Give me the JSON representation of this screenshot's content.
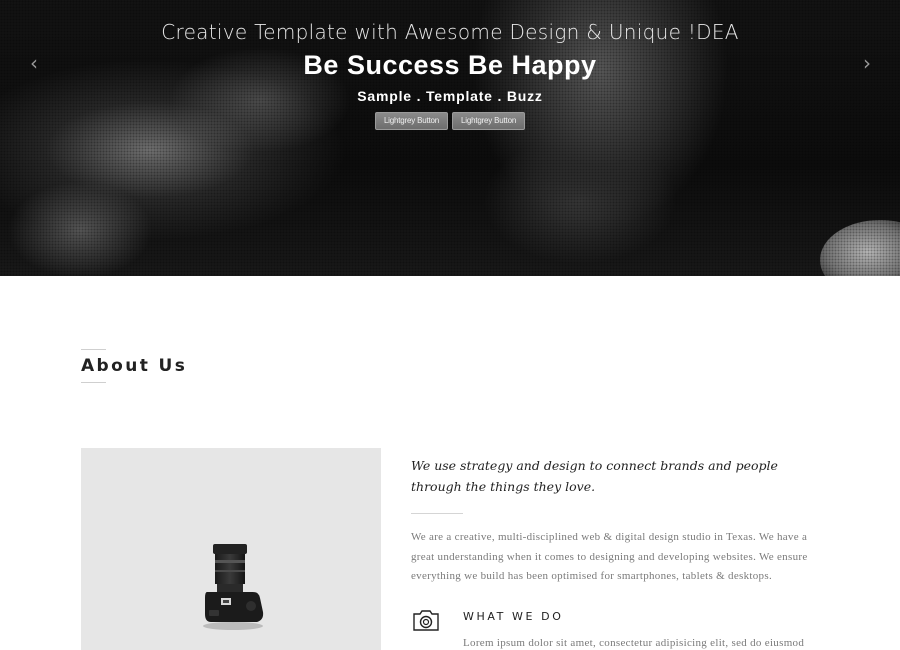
{
  "hero": {
    "tagline": "Creative Template with Awesome Design & Unique !DEA",
    "title": "Be Success Be Happy",
    "subtitle": "Sample . Template . Buzz",
    "buttons": [
      "Lightgrey Button",
      "Lightgrey Button"
    ],
    "prev_icon": "chevron-left-icon",
    "next_icon": "chevron-right-icon",
    "prev_glyph": "‹",
    "next_glyph": "›"
  },
  "about": {
    "heading": "About Us",
    "image_icon": "camera-photo",
    "lead": "We use strategy and design to connect brands and people through the things they love.",
    "body": "We are a creative, multi-disciplined web & digital design studio in Texas. We have a great understanding when it comes to designing and developing websites. We ensure everything we build has been optimised for smartphones, tablets & desktops.",
    "what_we_do": {
      "icon": "camera-icon",
      "title": "WHAT WE DO",
      "text": "Lorem ipsum dolor sit amet, consectetur adipisicing elit, sed do eiusmod"
    }
  }
}
